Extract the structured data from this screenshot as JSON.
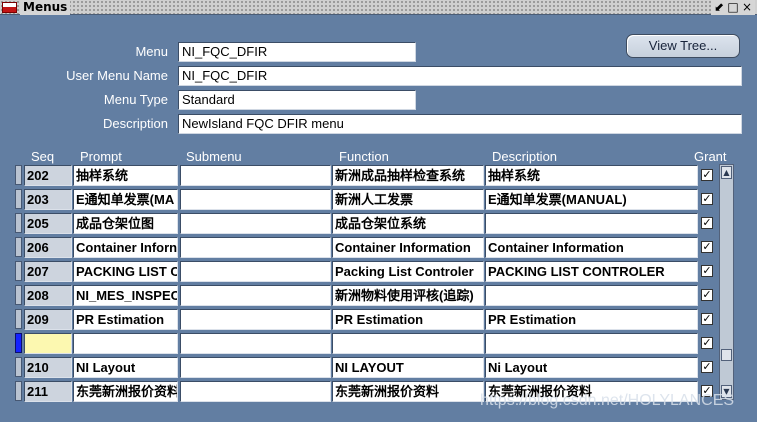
{
  "window": {
    "title": "Menus",
    "controls": {
      "minimize": "⬋",
      "maximize": "□",
      "close": "×"
    }
  },
  "form": {
    "menu_label": "Menu",
    "menu_value": "NI_FQC_DFIR",
    "user_menu_name_label": "User Menu Name",
    "user_menu_name_value": "NI_FQC_DFIR",
    "menu_type_label": "Menu Type",
    "menu_type_value": "Standard",
    "description_label": "Description",
    "description_value": "NewIsland FQC DFIR menu",
    "view_tree_label": "View Tree..."
  },
  "grid": {
    "headers": {
      "seq": "Seq",
      "prompt": "Prompt",
      "submenu": "Submenu",
      "function": "Function",
      "description": "Description",
      "grant": "Grant"
    },
    "rows": [
      {
        "seq": "202",
        "prompt": "抽样系统",
        "submenu": "",
        "function": "新洲成品抽样检查系统",
        "description": "抽样系统",
        "grant": "✓"
      },
      {
        "seq": "203",
        "prompt": "E通知单发票(MA",
        "submenu": "",
        "function": "新洲人工发票",
        "description": "E通知单发票(MANUAL)",
        "grant": "✓"
      },
      {
        "seq": "205",
        "prompt": "成品仓架位图",
        "submenu": "",
        "function": "成品仓架位系统",
        "description": "",
        "grant": "✓"
      },
      {
        "seq": "206",
        "prompt": "Container Inforn",
        "submenu": "",
        "function": "Container Information",
        "description": "Container Information",
        "grant": "✓"
      },
      {
        "seq": "207",
        "prompt": "PACKING LIST C",
        "submenu": "",
        "function": "Packing List Controler",
        "description": "PACKING LIST CONTROLER",
        "grant": "✓"
      },
      {
        "seq": "208",
        "prompt": "NI_MES_INSPEC",
        "submenu": "",
        "function": "新洲物料使用评核(追踪)",
        "description": "",
        "grant": "✓"
      },
      {
        "seq": "209",
        "prompt": "PR Estimation",
        "submenu": "",
        "function": "PR Estimation",
        "description": "PR Estimation",
        "grant": "✓"
      },
      {
        "seq": "",
        "prompt": "",
        "submenu": "",
        "function": "",
        "description": "",
        "grant": "✓"
      },
      {
        "seq": "210",
        "prompt": "NI Layout",
        "submenu": "",
        "function": "NI LAYOUT",
        "description": "Ni Layout",
        "grant": "✓"
      },
      {
        "seq": "211",
        "prompt": "东莞新洲报价资料",
        "submenu": "",
        "function": "东莞新洲报价资料",
        "description": "东莞新洲报价资料",
        "grant": "✓"
      }
    ]
  },
  "scrollbar": {
    "up": "▲",
    "down": "▼"
  },
  "watermark": "https://blog.csdn.net/HOLYLANCES",
  "colors": {
    "background": "#627ea2",
    "current_row_marker": "#1422ff",
    "current_seq_cell": "#fcf8b0"
  }
}
